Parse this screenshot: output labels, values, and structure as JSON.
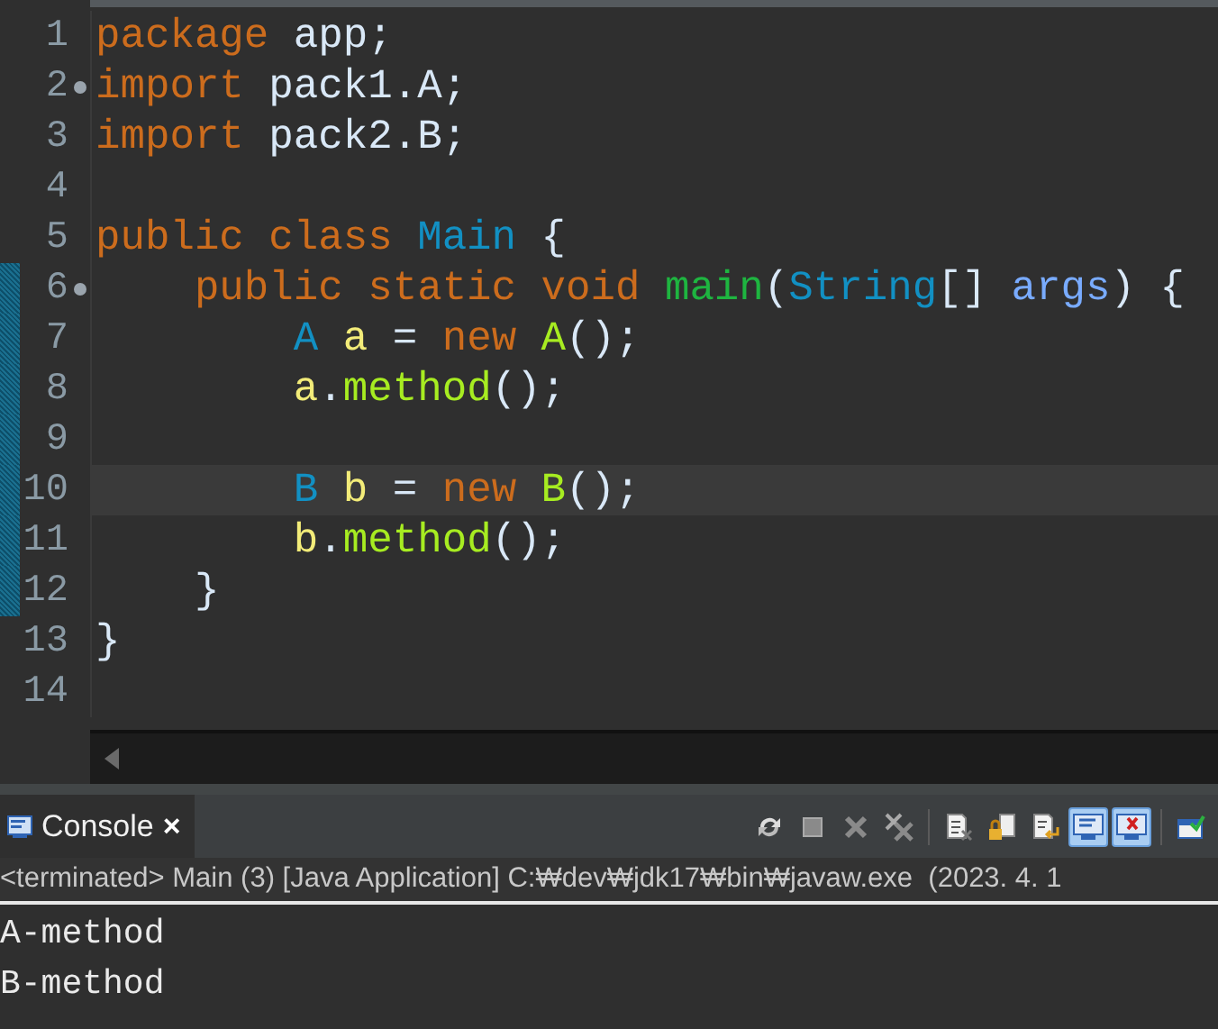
{
  "editor": {
    "lines": [
      {
        "number": "1",
        "tokens": [
          {
            "kind": "keyword",
            "text": "package"
          },
          {
            "kind": "plain",
            "text": " app;"
          }
        ]
      },
      {
        "number": "2",
        "fold": true,
        "tokens": [
          {
            "kind": "keyword",
            "text": "import"
          },
          {
            "kind": "plain",
            "text": " pack1.A;"
          }
        ]
      },
      {
        "number": "3",
        "tokens": [
          {
            "kind": "keyword",
            "text": "import"
          },
          {
            "kind": "plain",
            "text": " pack2.B;"
          }
        ]
      },
      {
        "number": "4"
      },
      {
        "number": "5",
        "tokens": [
          {
            "kind": "keyword",
            "text": "public class"
          },
          {
            "kind": "type",
            "text": " Main"
          },
          {
            "kind": "plain",
            "text": " {"
          }
        ]
      },
      {
        "number": "6",
        "fold": true,
        "changed": true,
        "tokens": [
          {
            "kind": "keyword",
            "text": "    public static void"
          },
          {
            "kind": "decl",
            "text": " main"
          },
          {
            "kind": "plain",
            "text": "("
          },
          {
            "kind": "type",
            "text": "String"
          },
          {
            "kind": "plain",
            "text": "[] "
          },
          {
            "kind": "param",
            "text": "args"
          },
          {
            "kind": "plain",
            "text": ") {"
          }
        ]
      },
      {
        "number": "7",
        "changed": true,
        "tokens": [
          {
            "kind": "type",
            "text": "        A"
          },
          {
            "kind": "var",
            "text": " a"
          },
          {
            "kind": "plain",
            "text": " = "
          },
          {
            "kind": "keyword",
            "text": "new"
          },
          {
            "kind": "call",
            "text": " A"
          },
          {
            "kind": "plain",
            "text": "();"
          }
        ]
      },
      {
        "number": "8",
        "changed": true,
        "tokens": [
          {
            "kind": "var",
            "text": "        a"
          },
          {
            "kind": "plain",
            "text": "."
          },
          {
            "kind": "call",
            "text": "method"
          },
          {
            "kind": "plain",
            "text": "();"
          }
        ]
      },
      {
        "number": "9",
        "changed": true
      },
      {
        "number": "10",
        "changed": true,
        "current": true,
        "tokens": [
          {
            "kind": "type",
            "text": "        B"
          },
          {
            "kind": "var",
            "text": " b"
          },
          {
            "kind": "plain",
            "text": " = "
          },
          {
            "kind": "keyword",
            "text": "new"
          },
          {
            "kind": "call",
            "text": " B"
          },
          {
            "kind": "plain",
            "text": "();"
          }
        ]
      },
      {
        "number": "11",
        "changed": true,
        "tokens": [
          {
            "kind": "var",
            "text": "        b"
          },
          {
            "kind": "plain",
            "text": "."
          },
          {
            "kind": "call",
            "text": "method"
          },
          {
            "kind": "plain",
            "text": "();"
          }
        ]
      },
      {
        "number": "12",
        "changed": true,
        "tokens": [
          {
            "kind": "plain",
            "text": "    }"
          }
        ]
      },
      {
        "number": "13",
        "tokens": [
          {
            "kind": "plain",
            "text": "}"
          }
        ]
      },
      {
        "number": "14"
      }
    ]
  },
  "console": {
    "tab": {
      "label": "Console",
      "close": "×"
    },
    "toolbar": [
      {
        "kind": "sync"
      },
      {
        "kind": "stop"
      },
      {
        "kind": "remove"
      },
      {
        "kind": "remove-all"
      },
      {
        "kind": "clear"
      },
      {
        "kind": "lock"
      },
      {
        "kind": "wrap"
      },
      {
        "kind": "stdout",
        "selected": true
      },
      {
        "kind": "stderr",
        "selected": true
      },
      {
        "kind": "open"
      }
    ],
    "status": "<terminated> Main (3) [Java Application] C:₩dev₩jdk17₩bin₩javaw.exe  (2023. 4. 1",
    "output": [
      "A-method",
      "B-method"
    ]
  }
}
